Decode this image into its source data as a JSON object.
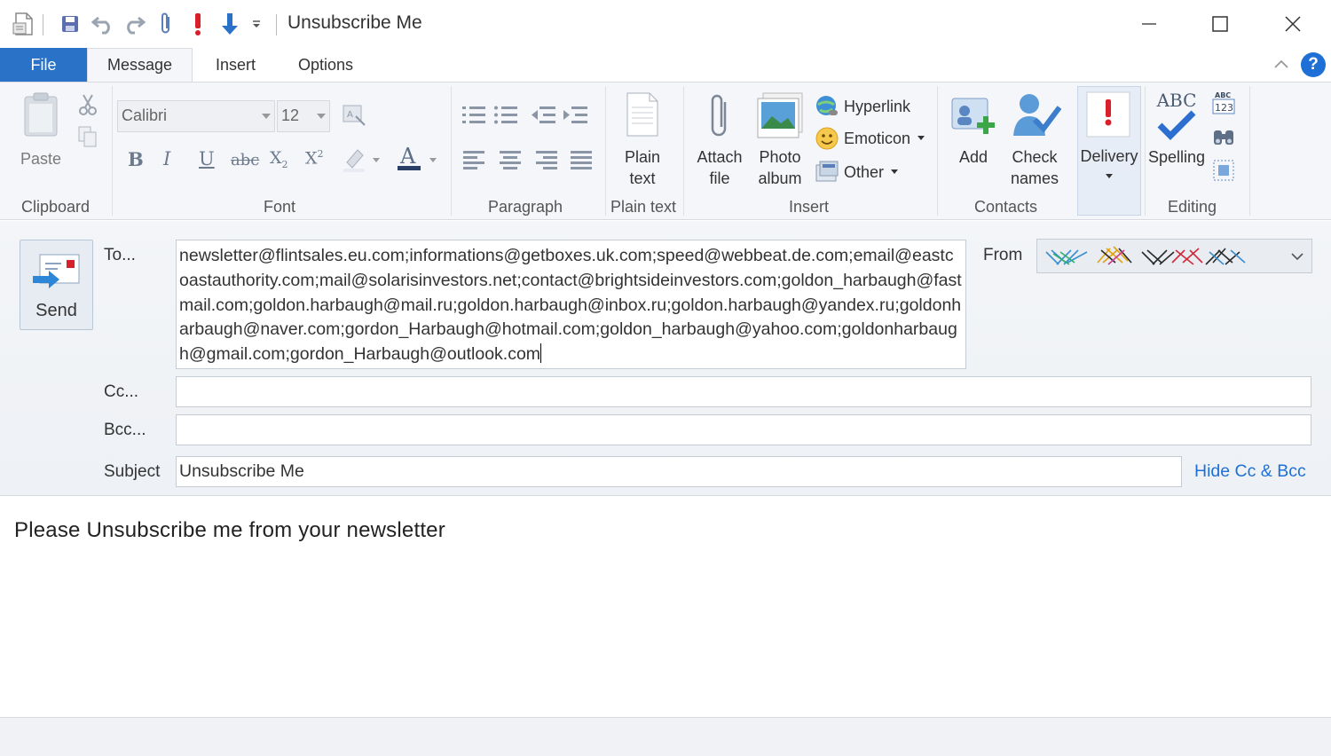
{
  "window": {
    "title": "Unsubscribe Me"
  },
  "tabs": {
    "file": "File",
    "message": "Message",
    "insert": "Insert",
    "options": "Options",
    "help": "?"
  },
  "ribbon": {
    "clipboard": {
      "label": "Clipboard",
      "paste": "Paste"
    },
    "font": {
      "label": "Font",
      "family": "Calibri",
      "size": "12"
    },
    "paragraph": {
      "label": "Paragraph"
    },
    "plaintext": {
      "label": "Plain text",
      "button_line1": "Plain",
      "button_line2": "text"
    },
    "insert": {
      "label": "Insert",
      "attach_line1": "Attach",
      "attach_line2": "file",
      "photo_line1": "Photo",
      "photo_line2": "album",
      "hyperlink": "Hyperlink",
      "emoticon": "Emoticon",
      "other": "Other"
    },
    "contacts": {
      "label": "Contacts",
      "add": "Add",
      "check_line1": "Check",
      "check_line2": "names"
    },
    "delivery": {
      "label": "Delivery"
    },
    "editing": {
      "label": "Editing",
      "spelling": "Spelling",
      "abc": "ABC"
    }
  },
  "compose": {
    "send": "Send",
    "to_label": "To...",
    "to_value": "newsletter@flintsales.eu.com;informations@getboxes.uk.com;speed@webbeat.de.com;email@eastcoastauthority.com;mail@solarisinvestors.net;contact@brightsideinvestors.com;goldon_harbaugh@fastmail.com;goldon.harbaugh@mail.ru;goldon.harbaugh@inbox.ru;goldon.harbaugh@yandex.ru;goldonharbaugh@naver.com;gordon_Harbaugh@hotmail.com;goldon_harbaugh@yahoo.com;goldonharbaugh@gmail.com;gordon_Harbaugh@outlook.com",
    "from_label": "From",
    "cc_label": "Cc...",
    "bcc_label": "Bcc...",
    "subject_label": "Subject",
    "subject_value": "Unsubscribe Me",
    "hide_cc_bcc": "Hide Cc & Bcc",
    "body": "Please Unsubscribe me from your newsletter"
  },
  "colors": {
    "accent": "#2a72c8",
    "link": "#1e6fd6",
    "priority_red": "#d9202a"
  }
}
